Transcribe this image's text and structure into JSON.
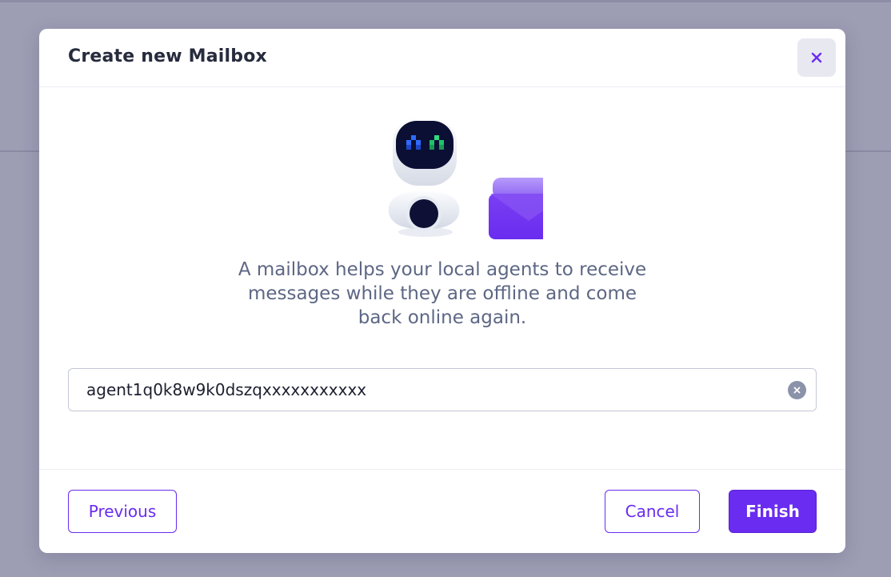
{
  "modal": {
    "title": "Create new Mailbox",
    "close_icon": "close-icon"
  },
  "illustration": {
    "robot_icon": "robot-icon",
    "envelope_icon": "envelope-icon"
  },
  "description": {
    "lines": [
      "A mailbox helps your local agents to receive",
      "messages while they are offline and come",
      "back online again."
    ]
  },
  "agent_input": {
    "value": "agent1q0k8w9k0dszqxxxxxxxxxxx",
    "clear_icon": "clear-icon"
  },
  "footer": {
    "previous_label": "Previous",
    "cancel_label": "Cancel",
    "finish_label": "Finish"
  },
  "colors": {
    "accent": "#6a2cf0",
    "title_text": "#262b3d",
    "body_text": "#5d6784",
    "overlay": "#9d9db4"
  }
}
